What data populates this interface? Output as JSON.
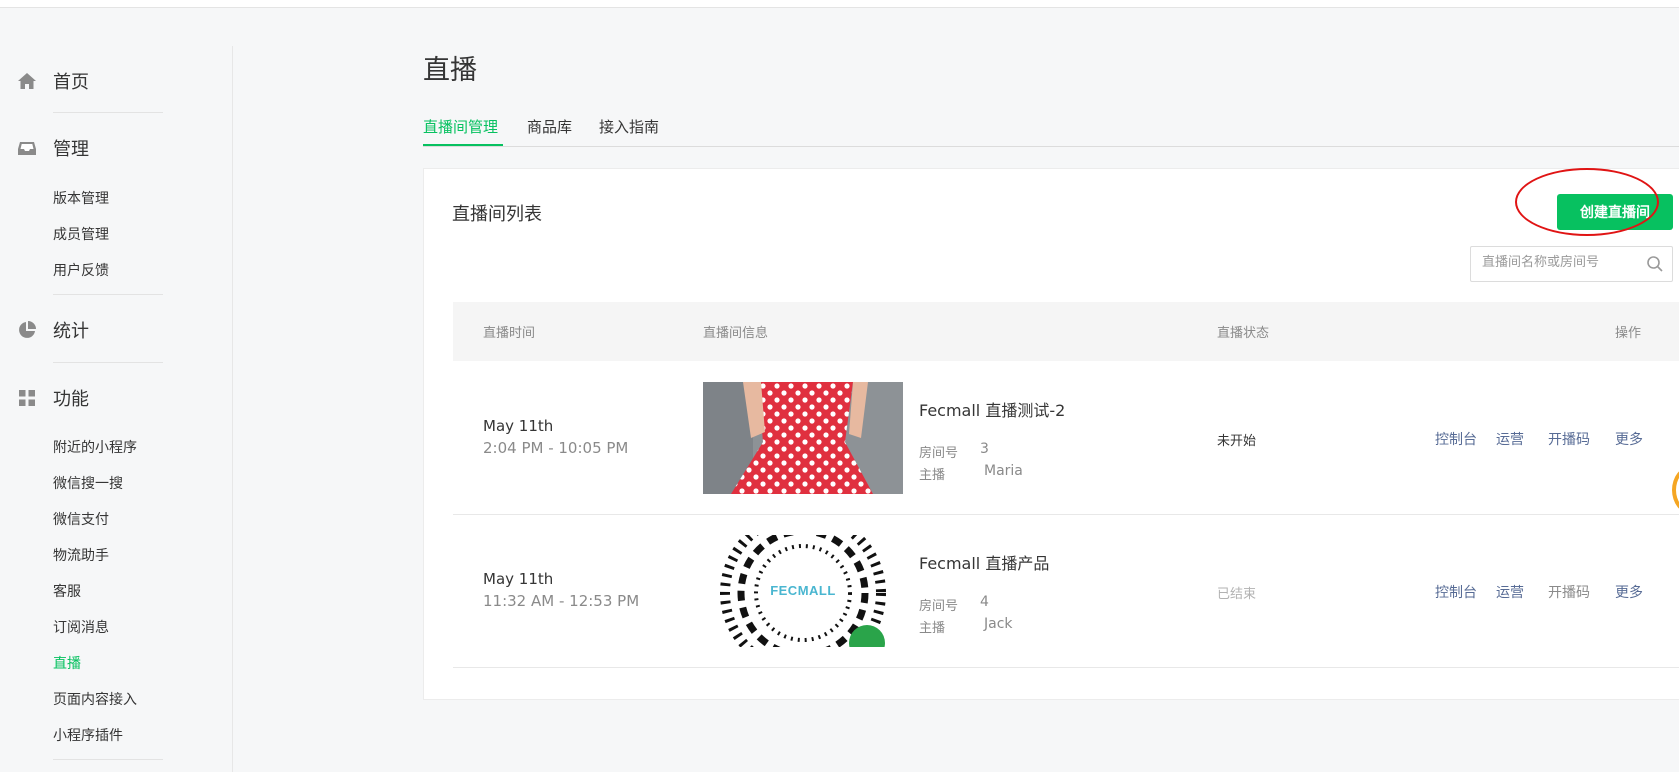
{
  "sidebar": {
    "home_label": "首页",
    "manage_label": "管理",
    "manage_items": [
      "版本管理",
      "成员管理",
      "用户反馈"
    ],
    "stats_label": "统计",
    "features_label": "功能",
    "feature_items": [
      "附近的小程序",
      "微信搜一搜",
      "微信支付",
      "物流助手",
      "客服",
      "订阅消息",
      "直播",
      "页面内容接入",
      "小程序插件"
    ],
    "active_item": "直播"
  },
  "page": {
    "title": "直播",
    "tabs": [
      "直播间管理",
      "商品库",
      "接入指南"
    ],
    "active_tab": "直播间管理"
  },
  "panel": {
    "title": "直播间列表",
    "create_button": "创建直播间",
    "search_placeholder": "直播间名称或房间号"
  },
  "table": {
    "columns": [
      "直播时间",
      "直播间信息",
      "直播状态",
      "操作"
    ],
    "room_no_label": "房间号",
    "anchor_label": "主播",
    "rows": [
      {
        "date": "May 11th",
        "time": "2:04 PM - 10:05 PM",
        "name": "Fecmall 直播测试-2",
        "room_no": "3",
        "anchor": "Maria",
        "status": "未开始",
        "actions": [
          "控制台",
          "运营",
          "开播码",
          "更多"
        ]
      },
      {
        "date": "May 11th",
        "time": "11:32 AM - 12:53 PM",
        "name": "Fecmall 直播产品",
        "room_no": "4",
        "anchor": "Jack",
        "status": "已结束",
        "actions": [
          "控制台",
          "运营",
          "开播码",
          "更多"
        ]
      }
    ]
  },
  "thumbnails": {
    "qr_logo_text": "FECMALL"
  },
  "colors": {
    "accent": "#07c160",
    "link": "#576b95",
    "highlight": "#e01414"
  }
}
